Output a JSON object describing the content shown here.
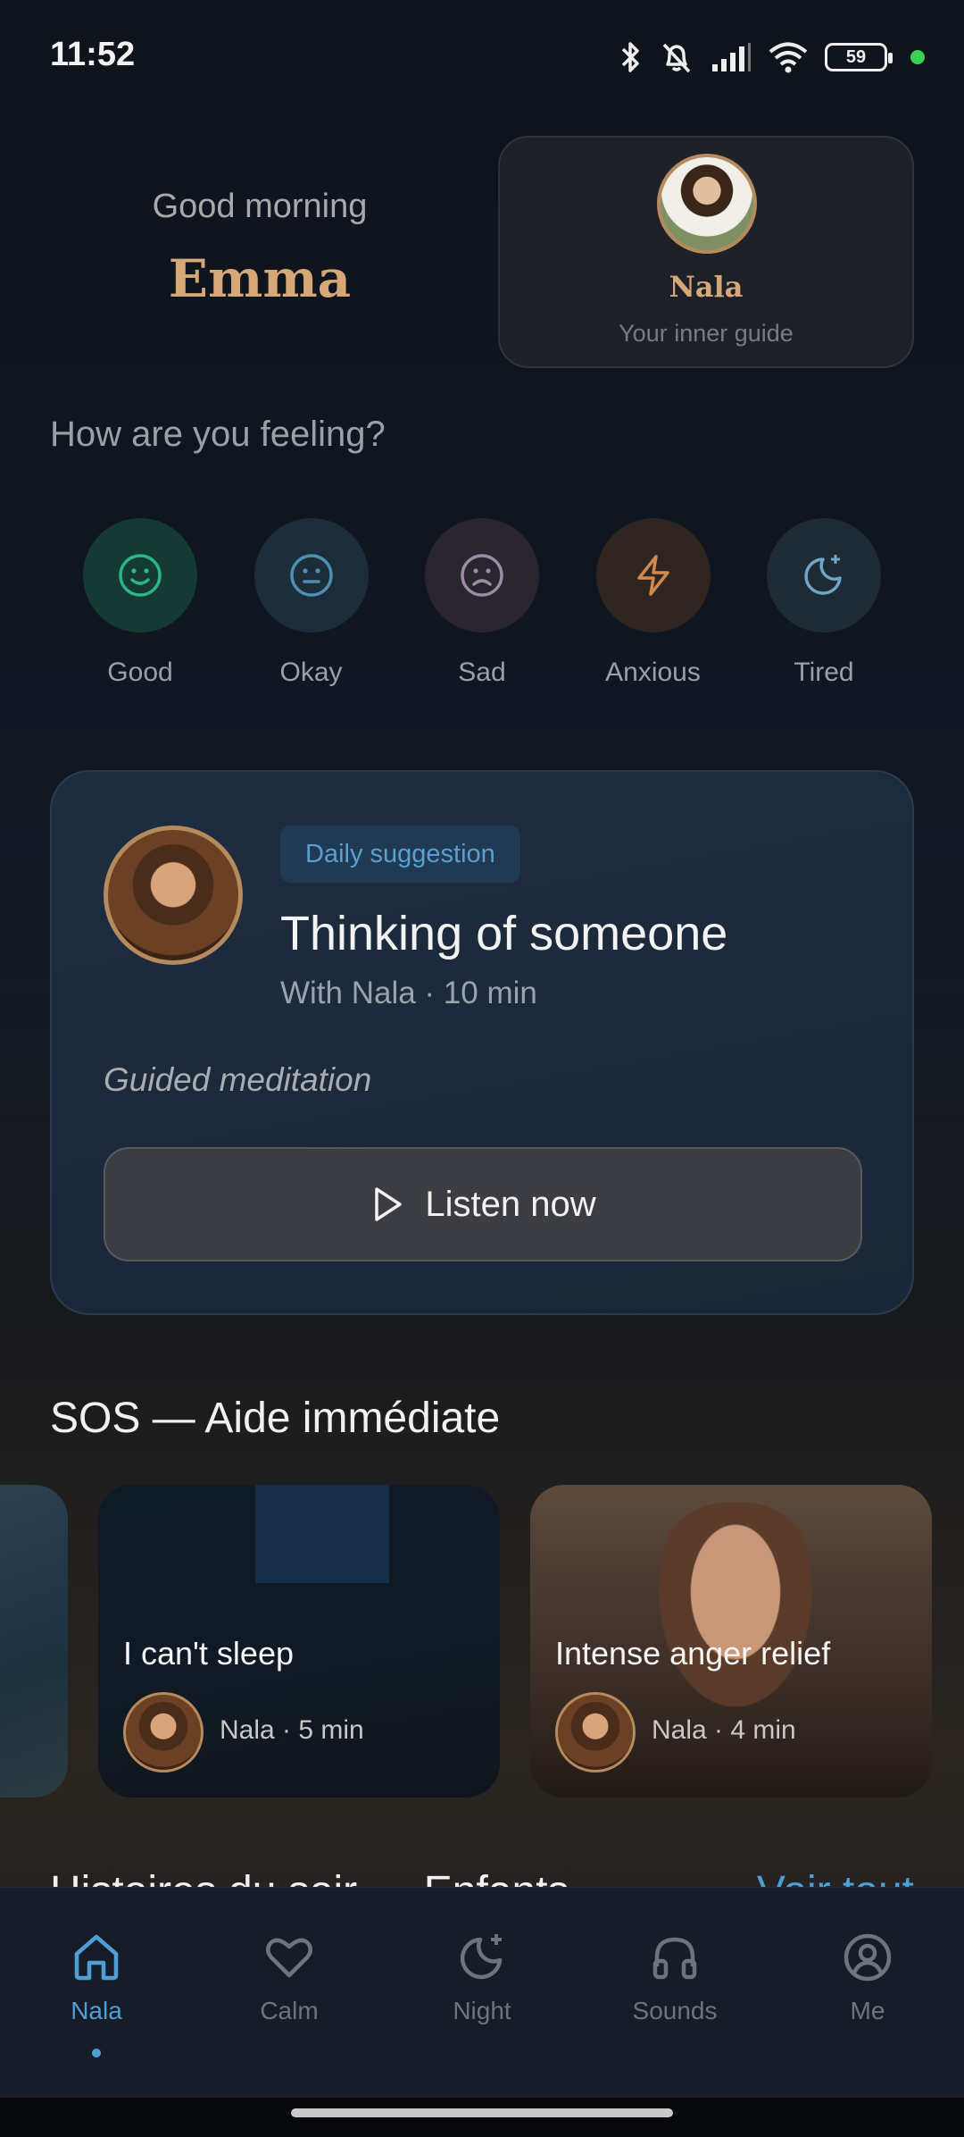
{
  "status_bar": {
    "time": "11:52",
    "battery": "59"
  },
  "header": {
    "greeting": "Good morning",
    "user_name": "Emma",
    "guide_name": "Nala",
    "guide_subtitle": "Your inner guide"
  },
  "mood": {
    "title": "How are you feeling?",
    "options": [
      {
        "label": "Good",
        "icon": "smile-icon",
        "color": "#2bb58a",
        "bg": "#153a33"
      },
      {
        "label": "Okay",
        "icon": "neutral-face-icon",
        "color": "#4d8fb3",
        "bg": "#1c2d3a"
      },
      {
        "label": "Sad",
        "icon": "sad-face-icon",
        "color": "#9a8aa3",
        "bg": "#29252f"
      },
      {
        "label": "Anxious",
        "icon": "lightning-icon",
        "color": "#d18a4e",
        "bg": "#2e2420"
      },
      {
        "label": "Tired",
        "icon": "moon-star-icon",
        "color": "#6fa6c6",
        "bg": "#1e2a34"
      }
    ]
  },
  "daily": {
    "badge": "Daily suggestion",
    "title": "Thinking of someone",
    "meta": "With Nala · 10 min",
    "type": "Guided meditation",
    "button_label": "Listen now"
  },
  "sos": {
    "title": "SOS — Aide immédiate",
    "cards": [
      {
        "title": "I can't sleep",
        "meta": "Nala · 5 min"
      },
      {
        "title": "Intense anger relief",
        "meta": "Nala · 4 min"
      }
    ]
  },
  "next_section": {
    "title_partial": "Histoires du soir — Enfants",
    "see_all": "Voir tout"
  },
  "nav": {
    "items": [
      {
        "label": "Nala",
        "icon": "home-icon",
        "active": true
      },
      {
        "label": "Calm",
        "icon": "heart-icon",
        "active": false
      },
      {
        "label": "Night",
        "icon": "moon-star-icon",
        "active": false
      },
      {
        "label": "Sounds",
        "icon": "headphones-icon",
        "active": false
      },
      {
        "label": "Me",
        "icon": "profile-icon",
        "active": false
      }
    ]
  },
  "colors": {
    "accent": "#4d9fd6",
    "gold": "#d6a878"
  }
}
